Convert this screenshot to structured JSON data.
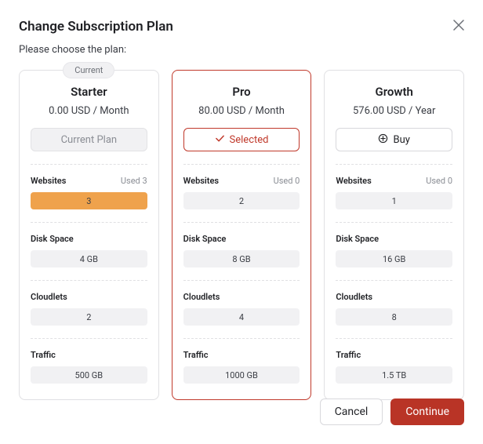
{
  "title": "Change Subscription Plan",
  "subtitle": "Please choose the plan:",
  "current_badge": "Current",
  "plans": [
    {
      "name": "Starter",
      "price": "0.00 USD / Month",
      "button": "Current Plan",
      "websites_label": "Websites",
      "websites_used": "Used 3",
      "websites_val": "3",
      "websites_fill": "100%",
      "disk_label": "Disk Space",
      "disk_val": "4 GB",
      "cloudlets_label": "Cloudlets",
      "cloudlets_val": "2",
      "traffic_label": "Traffic",
      "traffic_val": "500 GB"
    },
    {
      "name": "Pro",
      "price": "80.00 USD / Month",
      "button": "Selected",
      "websites_label": "Websites",
      "websites_used": "Used 0",
      "websites_val": "2",
      "websites_fill": "0%",
      "disk_label": "Disk Space",
      "disk_val": "8 GB",
      "cloudlets_label": "Cloudlets",
      "cloudlets_val": "4",
      "traffic_label": "Traffic",
      "traffic_val": "1000 GB"
    },
    {
      "name": "Growth",
      "price": "576.00 USD / Year",
      "button": "Buy",
      "websites_label": "Websites",
      "websites_used": "Used 0",
      "websites_val": "1",
      "websites_fill": "0%",
      "disk_label": "Disk Space",
      "disk_val": "16 GB",
      "cloudlets_label": "Cloudlets",
      "cloudlets_val": "8",
      "traffic_label": "Traffic",
      "traffic_val": "1.5 TB"
    }
  ],
  "footer": {
    "cancel": "Cancel",
    "continue": "Continue"
  }
}
